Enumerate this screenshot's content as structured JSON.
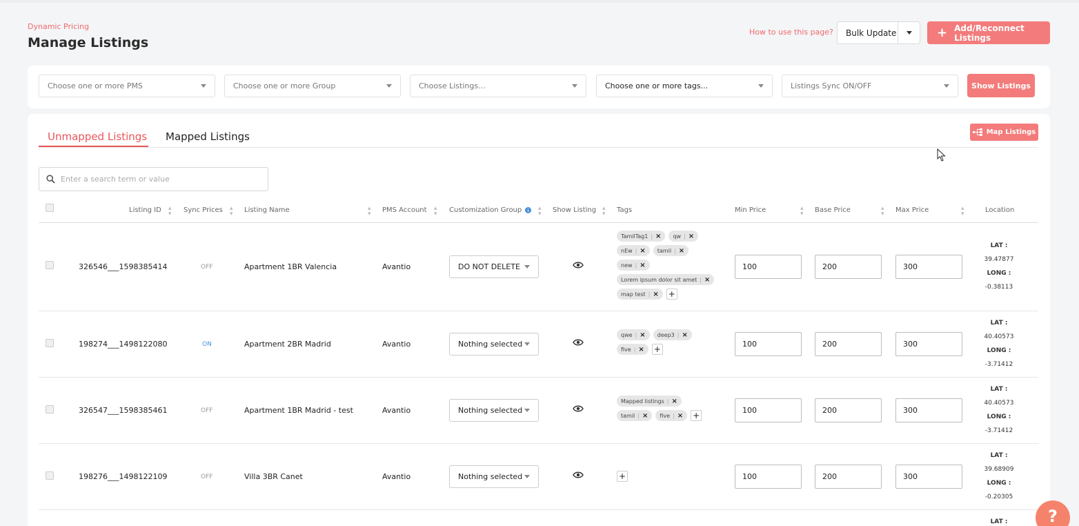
{
  "header": {
    "breadcrumb": "Dynamic Pricing",
    "title": "Manage Listings",
    "how_to": "How to use this page?",
    "bulk_update": "Bulk Update",
    "add_reconnect": "Add/Reconnect Listings"
  },
  "filters": {
    "pms": "Choose one or more PMS",
    "group": "Choose one or more Group",
    "listings": "Choose Listings...",
    "tags": "Choose one or more tags...",
    "sync": "Listings Sync ON/OFF",
    "show_button": "Show Listings"
  },
  "tabs": {
    "unmapped": "Unmapped Listings",
    "mapped": "Mapped Listings"
  },
  "map_button": "Map Listings",
  "search": {
    "placeholder": "Enter a search term or value"
  },
  "columns": {
    "listing_id": "Listing ID",
    "sync_prices": "Sync Prices",
    "listing_name": "Listing Name",
    "pms_account": "PMS Account",
    "customization_group": "Customization Group",
    "show_listing": "Show Listing",
    "tags": "Tags",
    "min_price": "Min Price",
    "base_price": "Base Price",
    "max_price": "Max Price",
    "location": "Location"
  },
  "loc_labels": {
    "lat": "LAT :",
    "long": "LONG :"
  },
  "rows": [
    {
      "id": "326546___1598385414",
      "sync": "OFF",
      "name": "Apartment 1BR Valencia",
      "pms": "Avantio",
      "group": "DO NOT DELETE",
      "tags": [
        "TamilTag1",
        "qw",
        "nEw",
        "tamil",
        "new",
        "Lorem ipsum dolor sit amet",
        "map test"
      ],
      "min": "100",
      "base": "200",
      "max": "300",
      "lat": "39.47877",
      "long": "-0.38113"
    },
    {
      "id": "198274___1498122080",
      "sync": "ON",
      "name": "Apartment 2BR Madrid",
      "pms": "Avantio",
      "group": "Nothing selected",
      "tags": [
        "qwe",
        "deep3",
        "five"
      ],
      "min": "100",
      "base": "200",
      "max": "300",
      "lat": "40.40573",
      "long": "-3.71412"
    },
    {
      "id": "326547___1598385461",
      "sync": "OFF",
      "name": "Apartment 1BR Madrid - test",
      "pms": "Avantio",
      "group": "Nothing selected",
      "tags": [
        "Mapped listings",
        "tamil",
        "five"
      ],
      "min": "100",
      "base": "200",
      "max": "300",
      "lat": "40.40573",
      "long": "-3.71412"
    },
    {
      "id": "198276___1498122109",
      "sync": "OFF",
      "name": "Villa 3BR Canet",
      "pms": "Avantio",
      "group": "Nothing selected",
      "tags": [],
      "min": "100",
      "base": "200",
      "max": "300",
      "lat": "39.68909",
      "long": "-0.20305"
    }
  ],
  "help": "?"
}
